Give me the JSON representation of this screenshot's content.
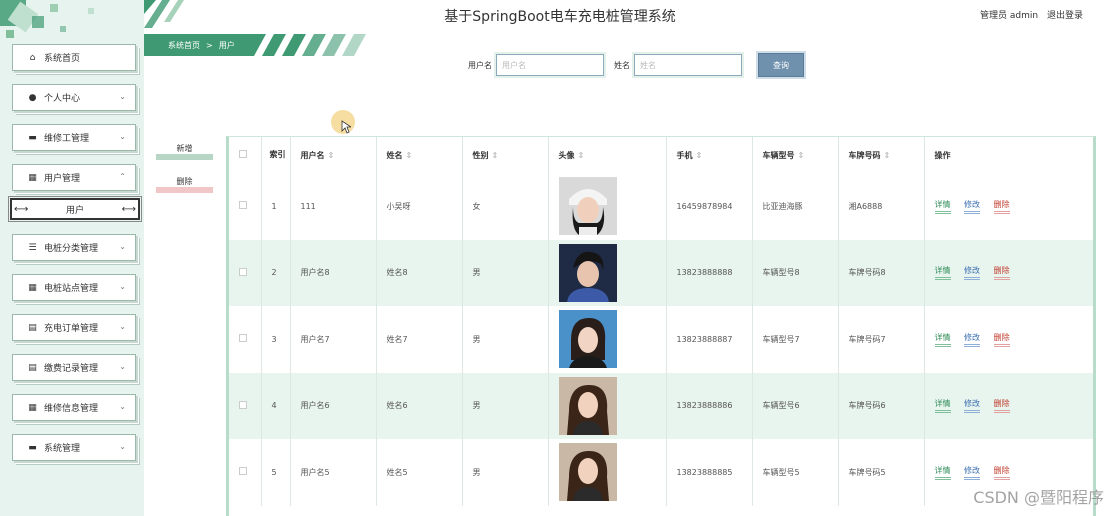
{
  "header": {
    "system_title": "基于SpringBoot电车充电桩管理系统",
    "role_user": "管理员 admin",
    "logout": "退出登录"
  },
  "breadcrumb": {
    "home": "系统首页",
    "separator": ">",
    "current": "用户"
  },
  "sidebar": {
    "items": [
      {
        "label": "系统首页",
        "icon": "home-icon",
        "chevron": ""
      },
      {
        "label": "个人中心",
        "icon": "person-icon",
        "chevron": "⌄"
      },
      {
        "label": "维修工管理",
        "icon": "monitor-icon",
        "chevron": "⌄"
      },
      {
        "label": "用户管理",
        "icon": "grid-icon",
        "chevron": "⌃"
      },
      {
        "label": "电桩分类管理",
        "icon": "list-icon",
        "chevron": "⌄"
      },
      {
        "label": "电桩站点管理",
        "icon": "grid-icon",
        "chevron": "⌄"
      },
      {
        "label": "充电订单管理",
        "icon": "clipboard-icon",
        "chevron": "⌄"
      },
      {
        "label": "缴费记录管理",
        "icon": "clipboard-icon",
        "chevron": "⌄"
      },
      {
        "label": "维修信息管理",
        "icon": "grid-icon",
        "chevron": "⌄"
      },
      {
        "label": "系统管理",
        "icon": "monitor-icon",
        "chevron": "⌄"
      }
    ],
    "sub_item": "用户"
  },
  "search": {
    "username_label": "用户名",
    "username_placeholder": "用户名",
    "name_label": "姓名",
    "name_placeholder": "姓名",
    "button": "查询"
  },
  "actions": {
    "add": "新增",
    "delete": "删除"
  },
  "table": {
    "index_header": "索引",
    "columns": [
      "用户名",
      "姓名",
      "性别",
      "头像",
      "手机",
      "车辆型号",
      "车牌号码",
      "操作"
    ],
    "rows": [
      {
        "index": "1",
        "username": "111",
        "name": "小吴呀",
        "gender": "女",
        "phone": "16459878984",
        "car_model": "比亚迪海豚",
        "plate": "湘A6888"
      },
      {
        "index": "2",
        "username": "用户名8",
        "name": "姓名8",
        "gender": "男",
        "phone": "13823888888",
        "car_model": "车辆型号8",
        "plate": "车牌号码8"
      },
      {
        "index": "3",
        "username": "用户名7",
        "name": "姓名7",
        "gender": "男",
        "phone": "13823888887",
        "car_model": "车辆型号7",
        "plate": "车牌号码7"
      },
      {
        "index": "4",
        "username": "用户名6",
        "name": "姓名6",
        "gender": "男",
        "phone": "13823888886",
        "car_model": "车辆型号6",
        "plate": "车牌号码6"
      },
      {
        "index": "5",
        "username": "用户名5",
        "name": "姓名5",
        "gender": "男",
        "phone": "13823888885",
        "car_model": "车辆型号5",
        "plate": "车牌号码5"
      }
    ],
    "ops": {
      "detail": "详情",
      "edit": "修改",
      "delete": "删除"
    }
  },
  "watermark": "CSDN @暨阳程序",
  "colors": {
    "accent": "#3f9a73",
    "sidebar_bg": "#e7f3ee",
    "search_btn": "#6f91ad",
    "row_even": "#e8f4ee"
  }
}
